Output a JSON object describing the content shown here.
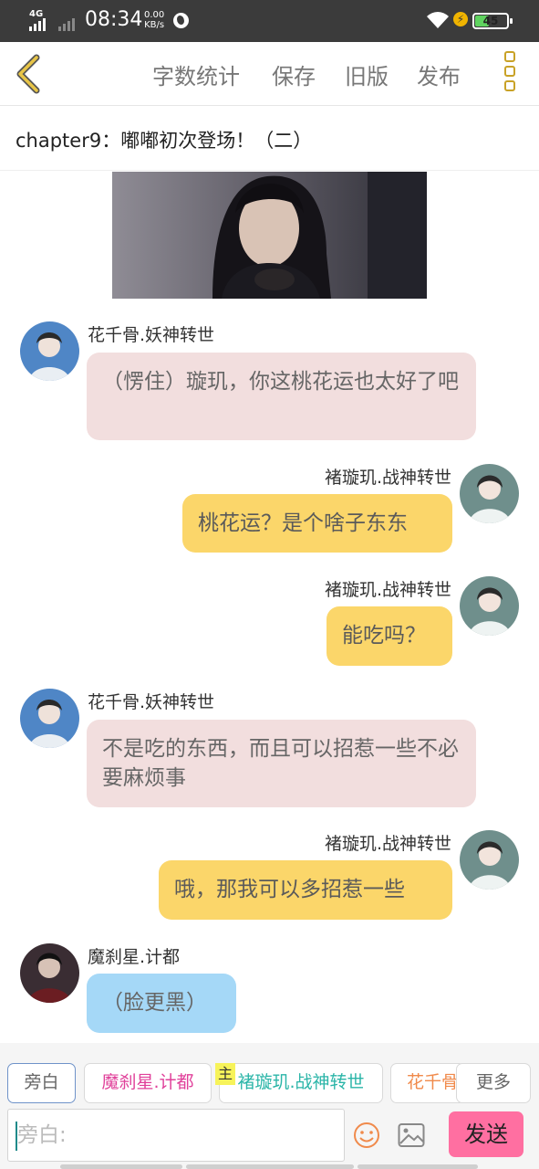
{
  "status_bar": {
    "network": "4G",
    "time": "08:34",
    "speed_value": "0.00",
    "speed_unit": "KB/s",
    "battery": "45",
    "battery_level": 0.45
  },
  "toolbar": {
    "word_count": "字数统计",
    "save": "保存",
    "old_version": "旧版",
    "publish": "发布"
  },
  "chapter_title": "chapter9：嘟嘟初次登场！（二）",
  "messages": [
    {
      "speaker": "花千骨.妖神转世",
      "text": "（愣住）璇玑，你这桃花运也太好了吧",
      "side": "left",
      "color": "#f2dede"
    },
    {
      "speaker": "褚璇玑.战神转世",
      "text": "桃花运？是个啥子东东",
      "side": "right",
      "color": "#fbd66a"
    },
    {
      "speaker": "褚璇玑.战神转世",
      "text": "能吃吗？",
      "side": "right",
      "color": "#fbd66a"
    },
    {
      "speaker": "花千骨.妖神转世",
      "text": "不是吃的东西，而且可以招惹一些不必要麻烦事",
      "side": "left",
      "color": "#f2dede"
    },
    {
      "speaker": "褚璇玑.战神转世",
      "text": "哦，那我可以多招惹一些",
      "side": "right",
      "color": "#fbd66a"
    },
    {
      "speaker": "魔刹星.计都",
      "text": "（脸更黑）",
      "side": "left",
      "color": "#a5d8f7"
    }
  ],
  "roles": {
    "narration": "旁白",
    "role1": "魔刹星.计都",
    "role2_tag": "主",
    "role2": "褚璇玑.战神转世",
    "role3": "花千骨",
    "more": "更多"
  },
  "input": {
    "placeholder": "旁白:",
    "value": ""
  },
  "send": "发送",
  "colors": {
    "accent_pink": "#ff6fa1",
    "icon_gold": "#c9a227",
    "role1_color": "#e0409a",
    "role2_color": "#2bb5a8",
    "role3_color": "#f08a4b"
  }
}
